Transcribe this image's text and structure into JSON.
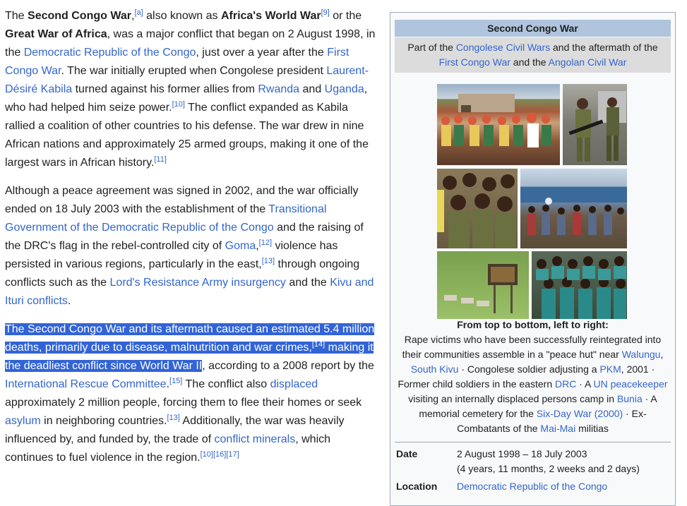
{
  "article": {
    "p1": {
      "s0": "The ",
      "b1": "Second Congo War",
      "s1": ",",
      "ref_a": "[a]",
      "s2": " also known as ",
      "b2": "Africa's World War",
      "ref9": "[9]",
      "s3": " or the ",
      "b3": "Great War of Africa",
      "s4": ", was a major conflict that began on 2 August 1998, in the ",
      "l1": "Democratic Republic of the Congo",
      "s5": ", just over a year after the ",
      "l2": "First Congo War",
      "s6": ". The war initially erupted when Congolese president ",
      "l3": "Laurent-Désiré Kabila",
      "s7": " turned against his former allies from ",
      "l4": "Rwanda",
      "s8": " and ",
      "l5": "Uganda",
      "s9": ", who had helped him seize power.",
      "ref10": "[10]",
      "s10": " The conflict expanded as Kabila rallied a coalition of other countries to his defense. The war drew in nine African nations and approximately 25 armed groups, making it one of the largest wars in African history.",
      "ref11": "[11]"
    },
    "p2": {
      "s0": "Although a peace agreement was signed in 2002, and the war officially ended on 18 July 2003 with the establishment of the ",
      "l1": "Transitional Government of the Democratic Republic of the Congo",
      "s1": " and the raising of the DRC's flag in the rebel-controlled city of ",
      "l2": "Goma",
      "s2": ",",
      "ref12": "[12]",
      "s3": " violence has persisted in various regions, particularly in the east,",
      "ref13": "[13]",
      "s4": " through ongoing conflicts such as the ",
      "l3": "Lord's Resistance Army insurgency",
      "s5": " and the ",
      "l4": "Kivu and Ituri conflicts",
      "s6": "."
    },
    "p3": {
      "h1": "The Second Congo War and its aftermath caused an estimated 5.4 million deaths, primarily due to disease, malnutrition and war crimes,",
      "ref14": "[14]",
      "h2": " making it the deadliest conflict since World War II",
      "s0": ", according to a 2008 report by the ",
      "l1": "International Rescue Committee",
      "s1": ".",
      "ref15": "[15]",
      "s2": " The conflict also ",
      "l2": "displaced",
      "s3": " approximately 2 million people, forcing them to flee their homes or seek ",
      "l3": "asylum",
      "s4": " in neighboring countries.",
      "ref13": "[13]",
      "s5": " Additionally, the war was heavily influenced by, and funded by, the trade of ",
      "l4": "conflict minerals",
      "s6": ", which continues to fuel violence in the region.",
      "ref10": "[10]",
      "ref16": "[16]",
      "ref17": "[17]"
    }
  },
  "infobox": {
    "title": "Second Congo War",
    "sub": {
      "s0": "Part of the ",
      "l1": "Congolese Civil Wars",
      "s1": " and the aftermath of the ",
      "l2": "First Congo War",
      "s2": " and the ",
      "l3": "Angolan Civil War"
    },
    "caption": {
      "head": "From top to bottom, left to right:",
      "s0": "Rape victims who have been successfully reintegrated into their communities assemble in a \"peace hut\" near ",
      "l1": "Walungu",
      "s1": ", ",
      "l2": "South Kivu",
      "s2": " · Congolese soldier adjusting a ",
      "l3": "PKM",
      "s3": ", 2001 · Former child soldiers in the eastern ",
      "l4": "DRC",
      "s4": " · A ",
      "l5": "UN peacekeeper",
      "s5": " visiting an internally displaced persons camp in ",
      "l6": "Bunia",
      "s6": " · A memorial cemetery for the ",
      "l7": "Six-Day War (2000)",
      "s7": " · Ex-Combatants of the ",
      "l8": "Mai-Mai",
      "s8": " militias"
    },
    "date": {
      "label": "Date",
      "value": "2 August 1998 – 18 July 2003",
      "duration": "(4 years, 11 months, 2 weeks and 2 days)"
    },
    "location": {
      "label": "Location",
      "value": "Democratic Republic of the Congo"
    }
  }
}
